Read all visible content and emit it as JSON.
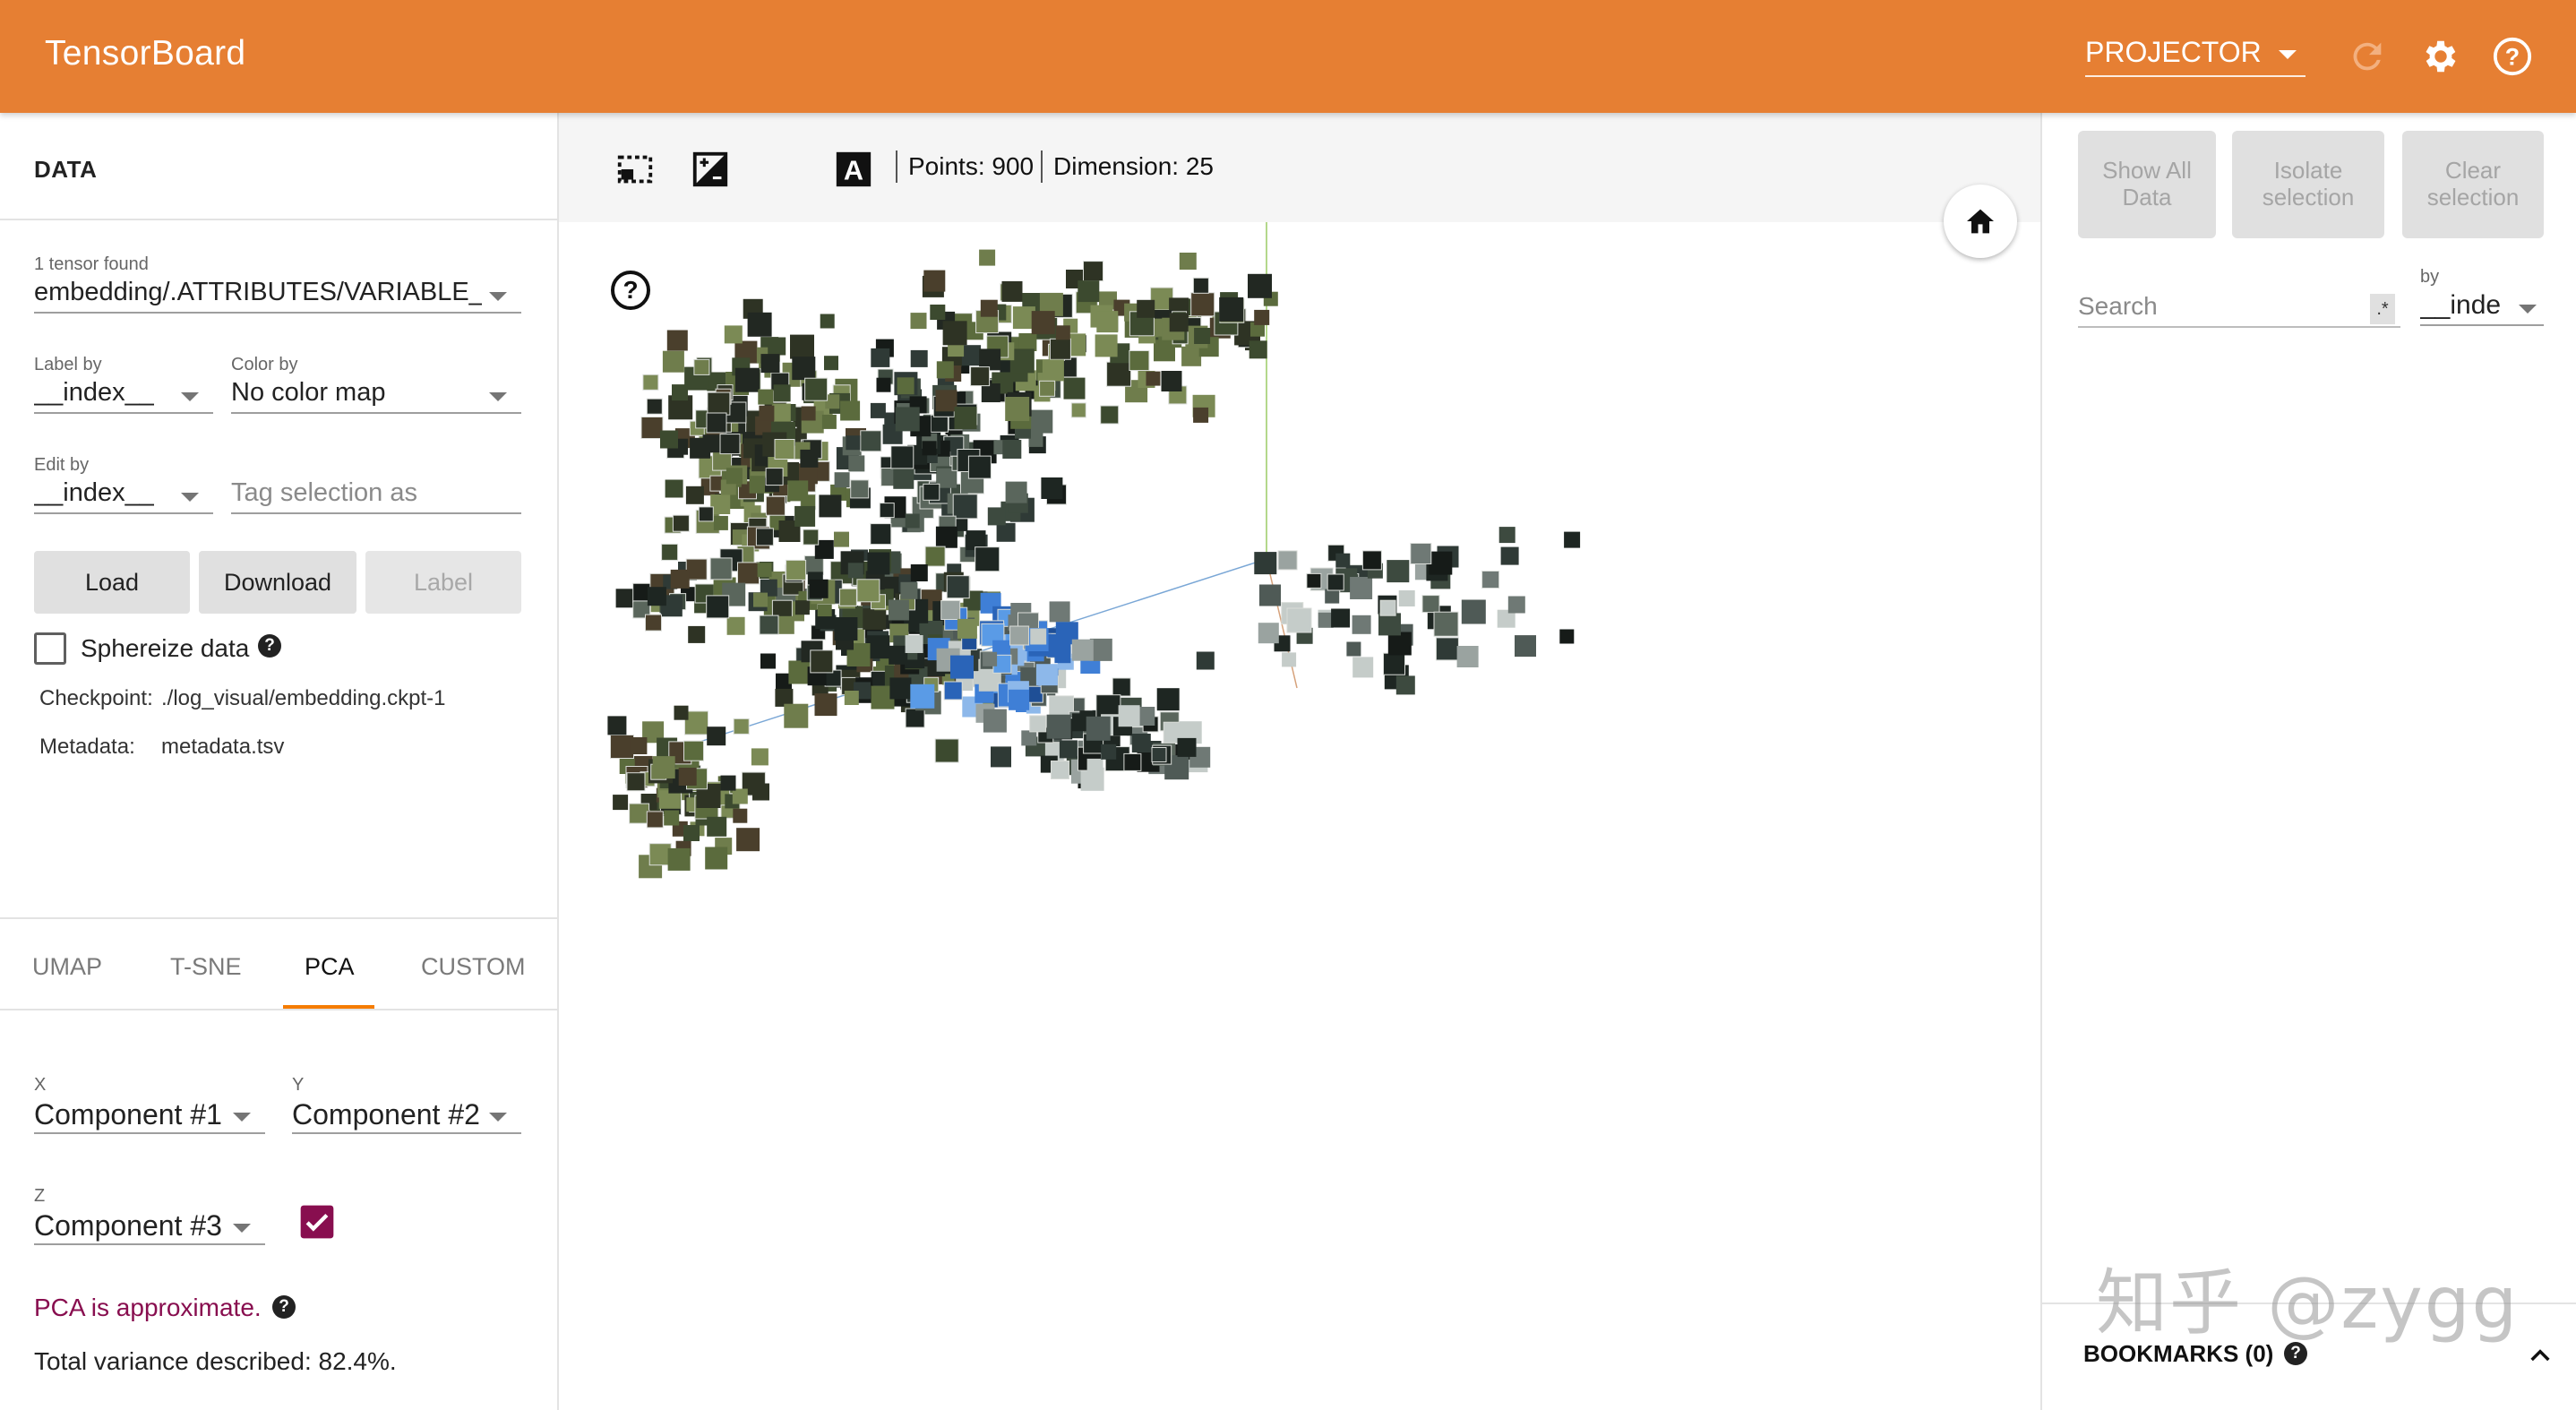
{
  "app": {
    "title": "TensorBoard",
    "accent_color": "#e67f33"
  },
  "header": {
    "plugin": "PROJECTOR",
    "icons": [
      "refresh-icon",
      "settings-icon",
      "help-icon"
    ]
  },
  "data_panel": {
    "title": "DATA",
    "tensor_found": "1 tensor found",
    "tensor_name": "embedding/.ATTRIBUTES/VARIABLE_",
    "label_by": {
      "label": "Label by",
      "value": "__index__"
    },
    "color_by": {
      "label": "Color by",
      "value": "No color map"
    },
    "edit_by": {
      "label": "Edit by",
      "value": "__index__"
    },
    "tag_placeholder": "Tag selection as",
    "buttons": {
      "load": "Load",
      "download": "Download",
      "label": "Label"
    },
    "sphereize": "Sphereize data",
    "checkpoint_label": "Checkpoint:",
    "checkpoint_value": "./log_visual/embedding.ckpt-1",
    "metadata_label": "Metadata:",
    "metadata_value": "metadata.tsv"
  },
  "projection_tabs": [
    "UMAP",
    "T-SNE",
    "PCA",
    "CUSTOM"
  ],
  "active_tab": "PCA",
  "pca": {
    "x": {
      "label": "X",
      "value": "Component #1"
    },
    "y": {
      "label": "Y",
      "value": "Component #2"
    },
    "z": {
      "label": "Z",
      "value": "Component #3"
    },
    "z_enabled": true,
    "approx_note": "PCA is approximate.",
    "variance": "Total variance described: 82.4%."
  },
  "toolbar": {
    "points": "Points: 900",
    "dimension": "Dimension: 25",
    "icons": [
      "select-region-icon",
      "night-mode-icon",
      "contrast-icon",
      "label-icon"
    ]
  },
  "inspector": {
    "buttons": [
      "Show All Data",
      "Isolate selection",
      "Clear selection"
    ],
    "search_placeholder": "Search",
    "regex": ".*",
    "by_label": "by",
    "by_value": "__inde",
    "bookmarks": "BOOKMARKS (0)"
  },
  "watermark": "知乎 @zygg",
  "colors": {
    "tab_underline": "#f57c00",
    "pca_note": "#880e4f",
    "checkbox_checked": "#880e4f"
  }
}
